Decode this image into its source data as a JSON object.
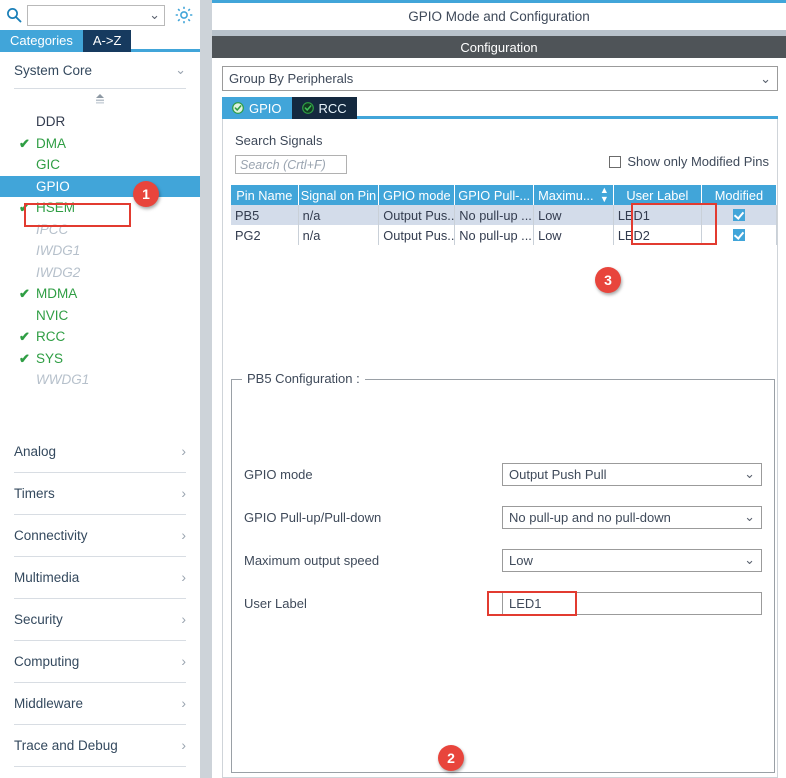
{
  "sidebar": {
    "search": {
      "value": "",
      "placeholder": ""
    },
    "icons": {
      "search": "search-icon",
      "gear": "gear-icon",
      "chevron": "⌄"
    },
    "tabs": [
      {
        "label": "Categories",
        "selected": true
      },
      {
        "label": "A->Z",
        "selected": false
      }
    ],
    "group": {
      "label": "System Core",
      "chevron": "⌄"
    },
    "peripherals": [
      {
        "label": "DDR",
        "check": false,
        "state": "normal"
      },
      {
        "label": "DMA",
        "check": true,
        "state": "active"
      },
      {
        "label": "GIC",
        "check": false,
        "state": "active"
      },
      {
        "label": "GPIO",
        "check": false,
        "state": "selected"
      },
      {
        "label": "HSEM",
        "check": true,
        "state": "active"
      },
      {
        "label": "IPCC",
        "check": false,
        "state": "disabled"
      },
      {
        "label": "IWDG1",
        "check": false,
        "state": "disabled"
      },
      {
        "label": "IWDG2",
        "check": false,
        "state": "disabled"
      },
      {
        "label": "MDMA",
        "check": true,
        "state": "active"
      },
      {
        "label": "NVIC",
        "check": false,
        "state": "active"
      },
      {
        "label": "RCC",
        "check": true,
        "state": "active"
      },
      {
        "label": "SYS",
        "check": true,
        "state": "active"
      },
      {
        "label": "WWDG1",
        "check": false,
        "state": "disabled"
      }
    ],
    "categories": [
      {
        "label": "Analog",
        "chevron": "›"
      },
      {
        "label": "Timers",
        "chevron": "›"
      },
      {
        "label": "Connectivity",
        "chevron": "›"
      },
      {
        "label": "Multimedia",
        "chevron": "›"
      },
      {
        "label": "Security",
        "chevron": "›"
      },
      {
        "label": "Computing",
        "chevron": "›"
      },
      {
        "label": "Middleware",
        "chevron": "›"
      },
      {
        "label": "Trace and Debug",
        "chevron": "›"
      }
    ]
  },
  "pane": {
    "title": "GPIO Mode and Configuration",
    "configuration_bar": "Configuration",
    "group_by": {
      "value": "Group By Peripherals",
      "chevron": "⌄"
    },
    "tabs": [
      {
        "label": "GPIO",
        "selected": true,
        "icon": "check-circle-icon"
      },
      {
        "label": "RCC",
        "selected": false,
        "icon": "check-circle-icon"
      }
    ],
    "search_signals_label": "Search Signals",
    "search_signals_input": {
      "value": "",
      "placeholder": "Search (Crtl+F)"
    },
    "show_modified": {
      "label": "Show only Modified Pins",
      "checked": false
    }
  },
  "table": {
    "columns": [
      "Pin Name",
      "Signal on Pin",
      "GPIO mode",
      "GPIO Pull-...",
      "Maximu...",
      "User Label",
      "Modified"
    ],
    "sorted_column_index": 4,
    "rows": [
      {
        "pin_name": "PB5",
        "signal_on_pin": "n/a",
        "gpio_mode": "Output Pus...",
        "gpio_pull": "No pull-up ...",
        "maximum_speed": "Low",
        "user_label": "LED1",
        "modified": true
      },
      {
        "pin_name": "PG2",
        "signal_on_pin": "n/a",
        "gpio_mode": "Output Pus...",
        "gpio_pull": "No pull-up ...",
        "maximum_speed": "Low",
        "user_label": "LED2",
        "modified": true
      }
    ]
  },
  "pin_config": {
    "legend": "PB5 Configuration :",
    "fields": [
      {
        "label": "GPIO mode",
        "value": "Output Push Pull",
        "type": "select"
      },
      {
        "label": "GPIO Pull-up/Pull-down",
        "value": "No pull-up and no pull-down",
        "type": "select"
      },
      {
        "label": "Maximum output speed",
        "value": "Low",
        "type": "select"
      },
      {
        "label": "User Label",
        "value": "LED1",
        "type": "input"
      }
    ],
    "chevron": "⌄"
  },
  "annotations": [
    {
      "number": "1"
    },
    {
      "number": "2"
    },
    {
      "number": "3"
    }
  ],
  "colors": {
    "accent_blue": "#41a5d9",
    "dark_tab": "#163a5f",
    "green_check": "#2f9e44",
    "badge_red": "#e8453c",
    "highlight_red": "#e23b30",
    "row_alt": "#d3dcea"
  }
}
